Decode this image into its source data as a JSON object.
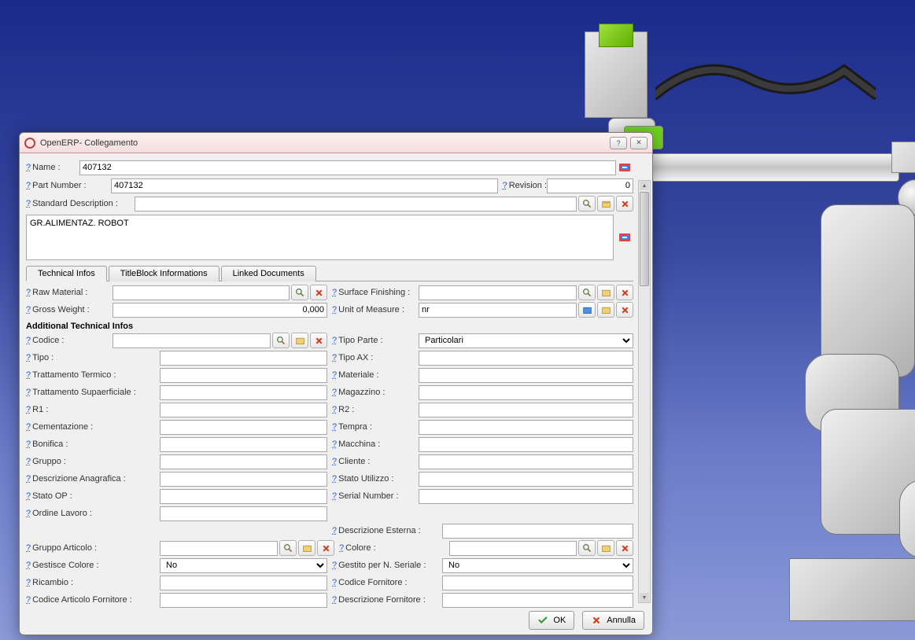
{
  "window": {
    "title": "OpenERP- Collegamento"
  },
  "header": {
    "name_label": "Name :",
    "name_value": "407132",
    "partnum_label": "Part Number :",
    "partnum_value": "407132",
    "revision_label": "Revision :",
    "revision_value": "0",
    "stddesc_label": "Standard Description :",
    "stddesc_value": "",
    "description_value": "GR.ALIMENTAZ. ROBOT"
  },
  "tabs": {
    "t1": "Technical Infos",
    "t2": "TitleBlock Informations",
    "t3": "Linked Documents"
  },
  "tech": {
    "raw_material_label": "Raw Material :",
    "raw_material_value": "",
    "surface_label": "Surface Finishing :",
    "surface_value": "",
    "gross_weight_label": "Gross Weight :",
    "gross_weight_value": "0,000",
    "uom_label": "Unit of Measure :",
    "uom_value": "nr",
    "section_title": "Additional Technical Infos",
    "codice_label": "Codice :",
    "codice_value": "",
    "tipo_parte_label": "Tipo Parte :",
    "tipo_parte_value": "Particolari",
    "tipo_label": "Tipo :",
    "tipo_value": "",
    "tipo_ax_label": "Tipo AX :",
    "tipo_ax_value": "",
    "tratt_term_label": "Trattamento Termico :",
    "tratt_term_value": "",
    "materiale_label": "Materiale :",
    "materiale_value": "",
    "tratt_sup_label": "Trattamento Supaerficiale :",
    "tratt_sup_value": "",
    "magazzino_label": "Magazzino :",
    "magazzino_value": "",
    "r1_label": "R1 :",
    "r1_value": "",
    "r2_label": "R2 :",
    "r2_value": "",
    "cementazione_label": "Cementazione :",
    "cementazione_value": "",
    "tempra_label": "Tempra :",
    "tempra_value": "",
    "bonifica_label": "Bonifica :",
    "bonifica_value": "",
    "macchina_label": "Macchina :",
    "macchina_value": "",
    "gruppo_label": "Gruppo :",
    "gruppo_value": "",
    "cliente_label": "Cliente :",
    "cliente_value": "",
    "desc_anag_label": "Descrizione Anagrafica :",
    "desc_anag_value": "",
    "stato_util_label": "Stato Utilizzo :",
    "stato_util_value": "",
    "stato_op_label": "Stato OP :",
    "stato_op_value": "",
    "serial_label": "Serial Number :",
    "serial_value": "",
    "ordine_label": "Ordine Lavoro :",
    "ordine_value": "",
    "desc_est_label": "Descrizione Esterna :",
    "desc_est_value": "",
    "gruppo_art_label": "Gruppo Articolo :",
    "gruppo_art_value": "",
    "colore_label": "Colore :",
    "colore_value": "",
    "gest_colore_label": "Gestisce Colore :",
    "gest_colore_value": "No",
    "gest_serial_label": "Gestito per N. Seriale :",
    "gest_serial_value": "No",
    "ricambio_label": "Ricambio :",
    "ricambio_value": "",
    "cod_forn_label": "Codice Fornitore :",
    "cod_forn_value": "",
    "cod_art_forn_label": "Codice Articolo Fornitore :",
    "cod_art_forn_value": "",
    "desc_forn_label": "Descrizione Fornitore :",
    "desc_forn_value": ""
  },
  "buttons": {
    "ok": "OK",
    "cancel": "Annulla"
  }
}
